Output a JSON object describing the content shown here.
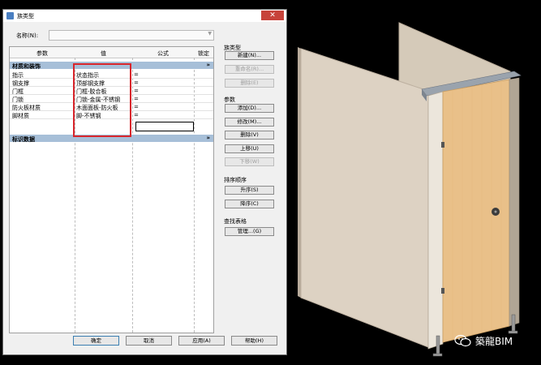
{
  "window": {
    "title": "族类型",
    "close_glyph": "✕"
  },
  "name_field": {
    "label": "名称(N):",
    "value": ""
  },
  "table": {
    "headers": [
      "参数",
      "值",
      "公式",
      "锁定"
    ],
    "groups": [
      {
        "title": "材质和装饰",
        "collapse_glyph": "»",
        "rows": [
          {
            "param": "指示",
            "value": "状态指示",
            "formula": "="
          },
          {
            "param": "钢支撑",
            "value": "顶部钢支撑",
            "formula": "="
          },
          {
            "param": "门框",
            "value": "门框-胶合板",
            "formula": "="
          },
          {
            "param": "门锁",
            "value": "门锁-金属-不锈钢",
            "formula": "="
          },
          {
            "param": "防火板材质",
            "value": "木面面板-防火板",
            "formula": "="
          },
          {
            "param": "脚材质",
            "value": "脚-不锈钢",
            "formula": "="
          }
        ]
      },
      {
        "title": "标识数据",
        "collapse_glyph": "»"
      }
    ]
  },
  "family_types": {
    "title": "族类型",
    "new": "新建(N)...",
    "rename": "重命名(R)...",
    "delete": "删除(E)"
  },
  "parameters": {
    "title": "参数",
    "add": "添加(D)...",
    "modify": "修改(M)...",
    "remove": "删除(V)",
    "move_up": "上移(U)",
    "move_down": "下移(W)"
  },
  "sort_order": {
    "title": "排序顺序",
    "ascending": "升序(S)",
    "descending": "降序(C)"
  },
  "lookup_tables": {
    "title": "查找表格",
    "manage": "管理...(G)"
  },
  "footer": {
    "ok": "确定",
    "cancel": "取消",
    "apply": "应用(A)",
    "help": "帮助(H)"
  },
  "watermark": {
    "text": "築龍BIM"
  },
  "colors": {
    "highlight_box": "#d8262c",
    "group_header": "#a7bfd8",
    "door_panel": "#e9c089",
    "partition": "#dcd1c3"
  }
}
